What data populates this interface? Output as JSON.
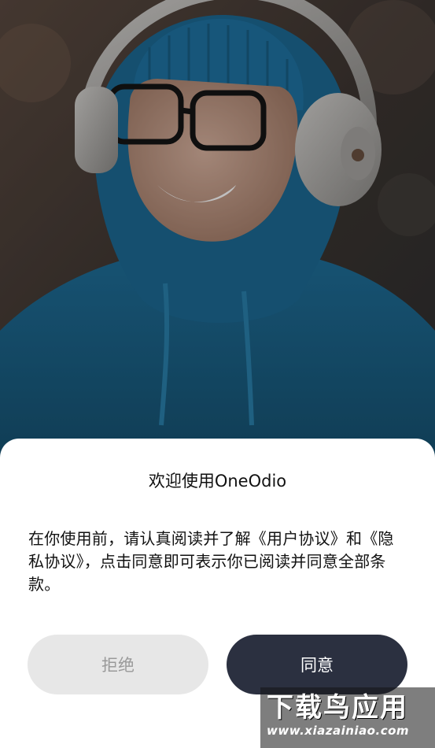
{
  "dialog": {
    "title": "欢迎使用OneOdio",
    "body": "在你使用前，请认真阅读并了解《用户协议》和《隐私协议》，点击同意即可表示你已阅读并同意全部条款。",
    "reject_label": "拒绝",
    "agree_label": "同意"
  },
  "watermark": {
    "main": "下载鸟应用",
    "sub": "www.xiazainiao.com"
  },
  "colors": {
    "agree_button": "#2b3040",
    "reject_button": "#e7e7e7",
    "reject_text": "#9a9a9a",
    "hoodie": "#1d5f86"
  },
  "icons": {
    "hero": "man-with-headphones-photo"
  }
}
